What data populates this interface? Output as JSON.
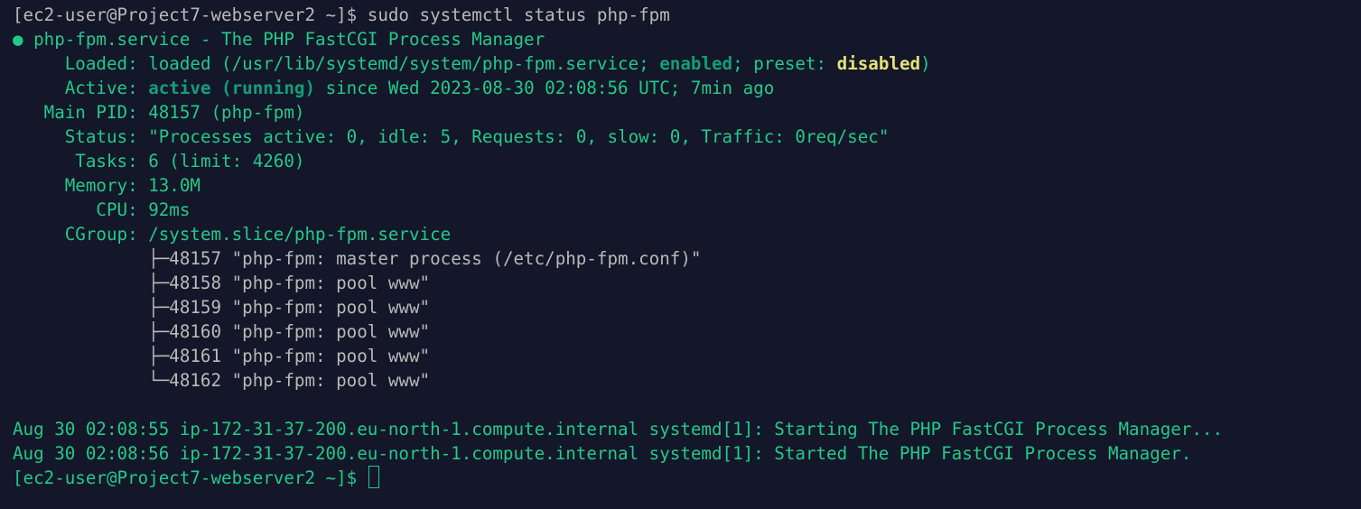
{
  "terminal": {
    "colors": {
      "background": "#131729",
      "text_green": "#23c98a",
      "text_grey": "#b9b9b9",
      "enabled_teal": "#129e79",
      "disabled_yellow": "#e6e07a"
    },
    "command_line": {
      "prompt": "[ec2-user@Project7-webserver2 ~]$ ",
      "command": "sudo systemctl status php-fpm"
    },
    "unit_line": {
      "bullet": "●",
      "text": " php-fpm.service - The PHP FastCGI Process Manager"
    },
    "loaded": {
      "label": "     Loaded: ",
      "pre": "loaded (/usr/lib/systemd/system/php-fpm.service; ",
      "enabled": "enabled",
      "mid": "; preset: ",
      "disabled": "disabled",
      "post": ")"
    },
    "active": {
      "label": "     Active: ",
      "state": "active (running)",
      "since": " since Wed 2023-08-30 02:08:56 UTC; 7min ago"
    },
    "main_pid": {
      "label": "   Main PID: ",
      "value": "48157 (php-fpm)"
    },
    "status": {
      "label": "     Status: ",
      "value": "\"Processes active: 0, idle: 5, Requests: 0, slow: 0, Traffic: 0req/sec\""
    },
    "tasks": {
      "label": "      Tasks: ",
      "value": "6 (limit: 4260)"
    },
    "memory": {
      "label": "     Memory: ",
      "value": "13.0M"
    },
    "cpu": {
      "label": "        CPU: ",
      "value": "92ms"
    },
    "cgroup": {
      "label": "     CGroup: ",
      "value": "/system.slice/php-fpm.service"
    },
    "processes": [
      {
        "tree": "             ├─",
        "pid": "48157",
        "cmd": " \"php-fpm: master process (/etc/php-fpm.conf)\""
      },
      {
        "tree": "             ├─",
        "pid": "48158",
        "cmd": " \"php-fpm: pool www\""
      },
      {
        "tree": "             ├─",
        "pid": "48159",
        "cmd": " \"php-fpm: pool www\""
      },
      {
        "tree": "             ├─",
        "pid": "48160",
        "cmd": " \"php-fpm: pool www\""
      },
      {
        "tree": "             ├─",
        "pid": "48161",
        "cmd": " \"php-fpm: pool www\""
      },
      {
        "tree": "             └─",
        "pid": "48162",
        "cmd": " \"php-fpm: pool www\""
      }
    ],
    "log_lines": [
      "Aug 30 02:08:55 ip-172-31-37-200.eu-north-1.compute.internal systemd[1]: Starting The PHP FastCGI Process Manager...",
      "Aug 30 02:08:56 ip-172-31-37-200.eu-north-1.compute.internal systemd[1]: Started The PHP FastCGI Process Manager."
    ],
    "final_prompt": "[ec2-user@Project7-webserver2 ~]$ "
  }
}
